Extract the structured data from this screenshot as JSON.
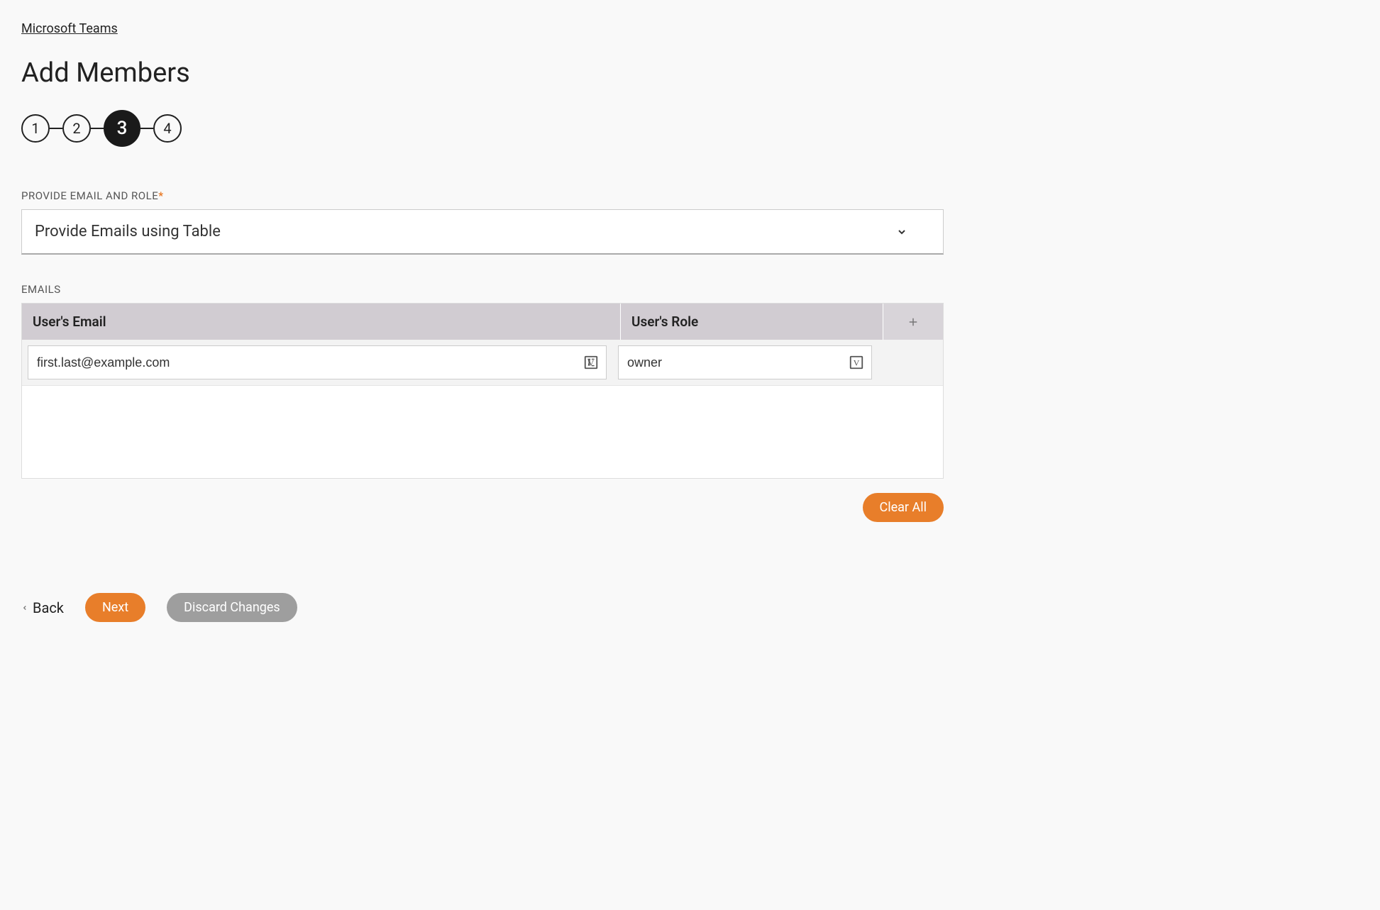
{
  "breadcrumb": "Microsoft Teams",
  "page_title": "Add Members",
  "stepper": {
    "steps": [
      "1",
      "2",
      "3",
      "4"
    ],
    "active_index": 2
  },
  "field": {
    "label": "PROVIDE EMAIL AND ROLE",
    "required_mark": "*",
    "select_value": "Provide Emails using Table"
  },
  "emails_section": {
    "label": "EMAILS",
    "columns": {
      "email": "User's Email",
      "role": "User's Role"
    },
    "rows": [
      {
        "email": "first.last@example.com",
        "role": "owner"
      }
    ]
  },
  "buttons": {
    "clear_all": "Clear All",
    "back": "Back",
    "next": "Next",
    "discard": "Discard Changes"
  }
}
